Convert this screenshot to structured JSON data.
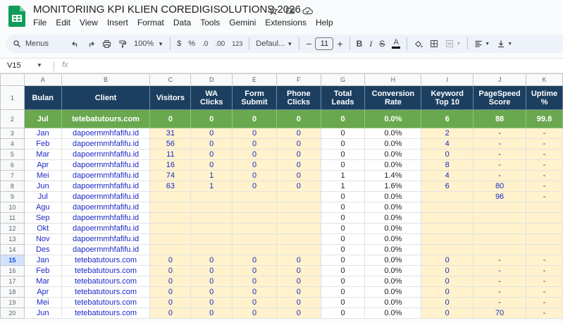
{
  "doc": {
    "title": "MONITORIING KPI KLIEN COREDIGISOLUTIONS 2026"
  },
  "menu": [
    "File",
    "Edit",
    "View",
    "Insert",
    "Format",
    "Data",
    "Tools",
    "Gemini",
    "Extensions",
    "Help"
  ],
  "toolbar": {
    "menus_label": "Menus",
    "zoom": "100%",
    "currency": "$",
    "percent": "%",
    "dec_less": ".0",
    "dec_more": ".00",
    "number_fmt": "123",
    "font": "Defaul...",
    "font_size": "11"
  },
  "formula": {
    "cell_ref": "V15",
    "fx": "fx"
  },
  "columns": [
    "A",
    "B",
    "C",
    "D",
    "E",
    "F",
    "G",
    "H",
    "I",
    "J",
    "K"
  ],
  "header": [
    "Bulan",
    "Client",
    "Visitors",
    "WA Clicks",
    "Form Submit",
    "Phone Clicks",
    "Total Leads",
    "Conversion Rate",
    "Keyword Top 10",
    "PageSpeed Score",
    "Uptime %"
  ],
  "summary": {
    "row": "2",
    "cells": [
      "Jul",
      "tetebatutours.com",
      "0",
      "0",
      "0",
      "0",
      "0",
      "0.0%",
      "6",
      "88",
      "99.8"
    ]
  },
  "rows": [
    {
      "n": "3",
      "cells": [
        "Jan",
        "dapoermmhfafifu.id",
        "31",
        "0",
        "0",
        "0",
        "0",
        "0.0%",
        "2",
        "-",
        "-"
      ]
    },
    {
      "n": "4",
      "cells": [
        "Feb",
        "dapoermmhfafifu.id",
        "56",
        "0",
        "0",
        "0",
        "0",
        "0.0%",
        "4",
        "-",
        "-"
      ]
    },
    {
      "n": "5",
      "cells": [
        "Mar",
        "dapoermmhfafifu.id",
        "11",
        "0",
        "0",
        "0",
        "0",
        "0.0%",
        "0",
        "-",
        "-"
      ]
    },
    {
      "n": "6",
      "cells": [
        "Apr",
        "dapoermmhfafifu.id",
        "16",
        "0",
        "0",
        "0",
        "0",
        "0.0%",
        "8",
        "-",
        "-"
      ]
    },
    {
      "n": "7",
      "cells": [
        "Mei",
        "dapoermmhfafifu.id",
        "74",
        "1",
        "0",
        "0",
        "1",
        "1.4%",
        "4",
        "-",
        "-"
      ]
    },
    {
      "n": "8",
      "cells": [
        "Jun",
        "dapoermmhfafifu.id",
        "63",
        "1",
        "0",
        "0",
        "1",
        "1.6%",
        "6",
        "80",
        "-"
      ]
    },
    {
      "n": "9",
      "cells": [
        "Jul",
        "dapoermmhfafifu.id",
        "",
        "",
        "",
        "",
        "0",
        "0.0%",
        "",
        "96",
        "-"
      ]
    },
    {
      "n": "10",
      "cells": [
        "Agu",
        "dapoermmhfafifu.id",
        "",
        "",
        "",
        "",
        "0",
        "0.0%",
        "",
        "",
        ""
      ]
    },
    {
      "n": "11",
      "cells": [
        "Sep",
        "dapoermmhfafifu.id",
        "",
        "",
        "",
        "",
        "0",
        "0.0%",
        "",
        "",
        ""
      ]
    },
    {
      "n": "12",
      "cells": [
        "Okt",
        "dapoermmhfafifu.id",
        "",
        "",
        "",
        "",
        "0",
        "0.0%",
        "",
        "",
        ""
      ]
    },
    {
      "n": "13",
      "cells": [
        "Nov",
        "dapoermmhfafifu.id",
        "",
        "",
        "",
        "",
        "0",
        "0.0%",
        "",
        "",
        ""
      ]
    },
    {
      "n": "14",
      "cells": [
        "Des",
        "dapoermmhfafifu.id",
        "",
        "",
        "",
        "",
        "0",
        "0.0%",
        "",
        "",
        ""
      ]
    },
    {
      "n": "15",
      "cells": [
        "Jan",
        "tetebatutours.com",
        "0",
        "0",
        "0",
        "0",
        "0",
        "0.0%",
        "0",
        "-",
        "-"
      ]
    },
    {
      "n": "16",
      "cells": [
        "Feb",
        "tetebatutours.com",
        "0",
        "0",
        "0",
        "0",
        "0",
        "0.0%",
        "0",
        "-",
        "-"
      ]
    },
    {
      "n": "17",
      "cells": [
        "Mar",
        "tetebatutours.com",
        "0",
        "0",
        "0",
        "0",
        "0",
        "0.0%",
        "0",
        "-",
        "-"
      ]
    },
    {
      "n": "18",
      "cells": [
        "Apr",
        "tetebatutours.com",
        "0",
        "0",
        "0",
        "0",
        "0",
        "0.0%",
        "0",
        "-",
        "-"
      ]
    },
    {
      "n": "19",
      "cells": [
        "Mei",
        "tetebatutours.com",
        "0",
        "0",
        "0",
        "0",
        "0",
        "0.0%",
        "0",
        "-",
        "-"
      ]
    },
    {
      "n": "20",
      "cells": [
        "Jun",
        "tetebatutours.com",
        "0",
        "0",
        "0",
        "0",
        "0",
        "0.0%",
        "0",
        "70",
        "-"
      ]
    }
  ],
  "selected_row": "15",
  "colors": {
    "header_bg": "#1c3f60",
    "summary_bg": "#6aa84f",
    "input_bg": "#fff2cc",
    "blue_text": "#1c29c4"
  }
}
